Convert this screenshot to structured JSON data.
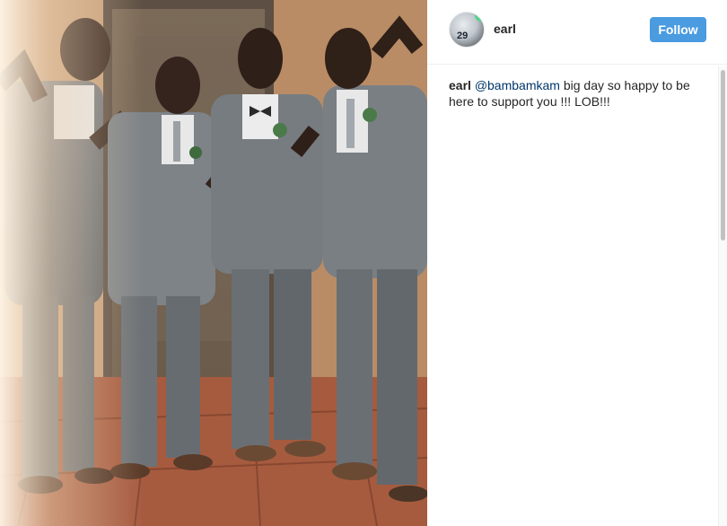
{
  "post": {
    "author": {
      "username": "earl",
      "avatar_icon": "profile-avatar-icon",
      "avatar_number": "29"
    },
    "follow_label": "Follow",
    "caption": {
      "username": "earl",
      "mention": "@bambamkam",
      "text": " big day so happy to be here to support you !!! LOB!!!"
    }
  },
  "colors": {
    "follow_button": "#4a9be0",
    "mention": "#003569",
    "suit": "#6f7479",
    "wall": "#c9a07a",
    "floor_tile": "#a0543a"
  }
}
